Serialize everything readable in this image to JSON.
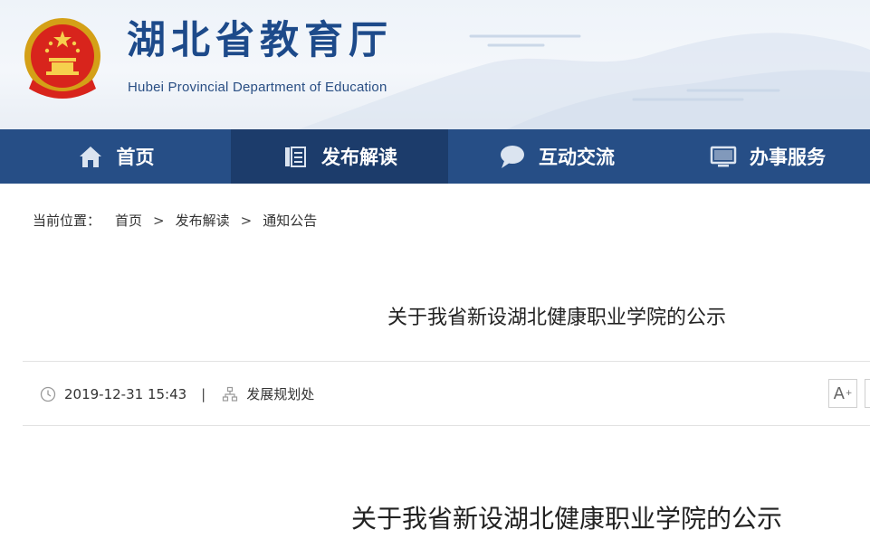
{
  "header": {
    "title": "湖北省教育厅",
    "subtitle": "Hubei Provincial Department of Education"
  },
  "nav": {
    "items": [
      {
        "label": "首页",
        "icon": "home-icon"
      },
      {
        "label": "发布解读",
        "icon": "document-list-icon",
        "active": true
      },
      {
        "label": "互动交流",
        "icon": "chat-bubble-icon"
      },
      {
        "label": "办事服务",
        "icon": "monitor-icon"
      }
    ]
  },
  "breadcrumb": {
    "prefix": "当前位置：",
    "items": [
      "首页",
      "发布解读",
      "通知公告"
    ],
    "separator": ">"
  },
  "article": {
    "title": "关于我省新设湖北健康职业学院的公示",
    "date": "2019-12-31 15:43",
    "meta_separator": "|",
    "department": "发展规划处",
    "font_button_label": "A",
    "font_button_sup": "+",
    "content_title": "关于我省新设湖北健康职业学院的公示"
  },
  "colors": {
    "nav_bg": "#264e86",
    "nav_active": "#1c3c6b",
    "title_blue": "#1d4a8a"
  }
}
